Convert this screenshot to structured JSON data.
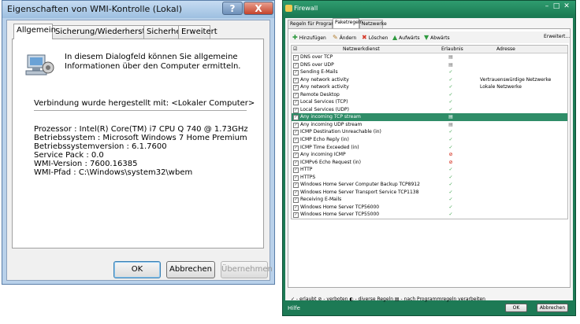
{
  "wmi_dialog": {
    "title": "Eigenschaften von WMI-Kontrolle (Lokal)",
    "help_label": "?",
    "close_label": "X",
    "tabs": [
      "Allgemein",
      "Sicherung/Wiederherstellung",
      "Sicherheit",
      "Erweitert"
    ],
    "intro": "In diesem Dialogfeld können Sie allgemeine Informationen über den Computer ermitteln.",
    "connection": "Verbindung wurde hergestellt mit: <Lokaler Computer>",
    "details": [
      "Prozessor : Intel(R) Core(TM) i7 CPU       Q 740  @ 1.73GHz",
      "Betriebssystem : Microsoft Windows 7 Home Premium",
      "Betriebssystemversion : 6.1.7600",
      "Service Pack : 0.0",
      "WMI-Version : 7600.16385",
      "WMI-Pfad : C:\\Windows\\system32\\wbem"
    ],
    "buttons": {
      "ok": "OK",
      "cancel": "Abbrechen",
      "apply": "Übernehmen"
    }
  },
  "firewall": {
    "title": "Firewall",
    "tabs": [
      "Regeln für Programme",
      "Paketregeln",
      "Netzwerke"
    ],
    "toolbar": {
      "add": "Hinzufügen",
      "edit": "Ändern",
      "delete": "Löschen",
      "up": "Aufwärts",
      "down": "Abwärts",
      "advanced": "Erweitert..."
    },
    "columns": {
      "service": "Netzwerkdienst",
      "result": "Erlaubnis",
      "address": "Adresse"
    },
    "rules": [
      {
        "name": "DNS over TCP",
        "result": "prog",
        "address": ""
      },
      {
        "name": "DNS over UDP",
        "result": "prog",
        "address": ""
      },
      {
        "name": "Sending E-Mails",
        "result": "ok",
        "address": ""
      },
      {
        "name": "Any network activity",
        "result": "ok",
        "address": "Vertrauenswürdige Netzwerke"
      },
      {
        "name": "Any network activity",
        "result": "ok",
        "address": "Lokale Netzwerke"
      },
      {
        "name": "Remote Desktop",
        "result": "ok",
        "address": ""
      },
      {
        "name": "Local Services (TCP)",
        "result": "ok",
        "address": ""
      },
      {
        "name": "Local Services (UDP)",
        "result": "ok",
        "address": ""
      },
      {
        "name": "Any incoming TCP stream",
        "result": "prog",
        "address": ""
      },
      {
        "name": "Any incoming UDP stream",
        "result": "prog",
        "address": ""
      },
      {
        "name": "ICMP Destination Unreachable (in)",
        "result": "ok",
        "address": ""
      },
      {
        "name": "ICMP Echo Reply (in)",
        "result": "ok",
        "address": ""
      },
      {
        "name": "ICMP Time Exceeded (in)",
        "result": "ok",
        "address": ""
      },
      {
        "name": "Any incoming ICMP",
        "result": "deny",
        "address": ""
      },
      {
        "name": "ICMPv6 Echo Request (in)",
        "result": "deny",
        "address": ""
      },
      {
        "name": "HTTP",
        "result": "ok",
        "address": ""
      },
      {
        "name": "HTTPS",
        "result": "ok",
        "address": ""
      },
      {
        "name": "Windows Home Server Computer Backup TCP8912",
        "result": "ok",
        "address": ""
      },
      {
        "name": "Windows Home Server Transport Service TCP1138",
        "result": "ok",
        "address": ""
      },
      {
        "name": "Receiving E-Mails",
        "result": "ok",
        "address": ""
      },
      {
        "name": "Windows Home Server TCP56000",
        "result": "ok",
        "address": ""
      },
      {
        "name": "Windows Home Server TCP55000",
        "result": "ok",
        "address": ""
      }
    ],
    "selected_row": 8,
    "legend": "✓ - erlaubt  ⊘ - verboten  ◐ - diverse Regeln  ▤ - nach Programmregeln verarbeiten",
    "footer": {
      "help": "Hilfe",
      "ok": "OK",
      "cancel": "Abbrechen"
    },
    "colors": {
      "frame": "#1d7a55",
      "selection": "#2f8d68",
      "allow": "#3ba34b",
      "deny": "#d53a2a"
    }
  }
}
